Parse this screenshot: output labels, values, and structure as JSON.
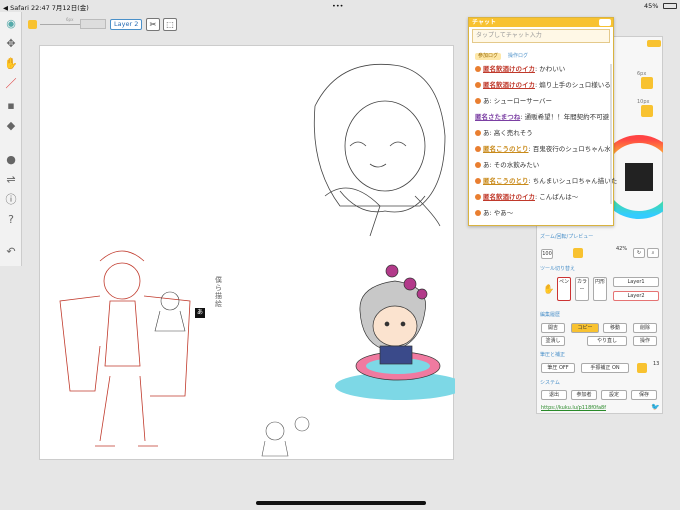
{
  "status": {
    "left": "◀ Safari  22:47  7月12日(金)",
    "dots": "•••",
    "battery": "45%"
  },
  "top": {
    "layer_btn": "Layer 2",
    "size": "6px"
  },
  "chat": {
    "title": "チャット",
    "input_placeholder": "タップしてチャット入力",
    "tabs": [
      "参加ログ",
      "操作ログ"
    ],
    "messages": [
      {
        "user": "匿名飲酒けのイカ",
        "text": ": かわいい",
        "style": "u1",
        "icon": true
      },
      {
        "user": "匿名飲酒けのイカ",
        "text": ": 煽り上手のシュロ様いる",
        "style": "u1",
        "icon": true
      },
      {
        "user": "あ",
        "text": ": シューローサーバー",
        "style": "",
        "icon": true
      },
      {
        "user": "匿名さたまつね",
        "text": ": 通販希望！！年間契約不可避",
        "style": "u3",
        "icon": false
      },
      {
        "user": "あ",
        "text": ": 高く売れそう",
        "style": "",
        "icon": true
      },
      {
        "user": "匿名こうのとり",
        "text": ": 百鬼夜行のシュロちゃん水",
        "style": "u2",
        "icon": true
      },
      {
        "user": "あ",
        "text": ": その水飲みたい",
        "style": "",
        "icon": true
      },
      {
        "user": "匿名こうのとり",
        "text": ": ちんまいシュロちゃん描いた",
        "style": "u2",
        "icon": true
      },
      {
        "user": "匿名飲酒けのイカ",
        "text": ": こんばんは〜",
        "style": "u1",
        "icon": true
      },
      {
        "user": "あ",
        "text": ": やあ〜",
        "style": "",
        "icon": true
      }
    ]
  },
  "panel": {
    "px1": "6px",
    "px2": "10px",
    "zoom_title": "ズーム/回転/プレビュー",
    "zoom_val": "100",
    "pct": "42%",
    "tool_title": "ツール切り替え",
    "tools": [
      "ペン",
      "カラー",
      "円形"
    ],
    "layers": [
      "Layer1",
      "Layer2"
    ],
    "edit_title": "編集履歴",
    "edit_row1": [
      "開吉",
      "コピー",
      "移動",
      "削除"
    ],
    "edit_row2": [
      "塗潰し",
      "やり直し",
      "操作"
    ],
    "assist_title": "筆圧と補正",
    "assist_btns": [
      "筆圧 OFF",
      "手振補正 ON"
    ],
    "assist_val": "13",
    "sys_title": "システム",
    "sys_btns": [
      "退出",
      "参加者",
      "設定",
      "保存"
    ],
    "url": "https://kuku.lu/p118f0fa8f"
  },
  "canvas": {
    "note": "あ",
    "vertical_text": "僕ら描絵"
  }
}
